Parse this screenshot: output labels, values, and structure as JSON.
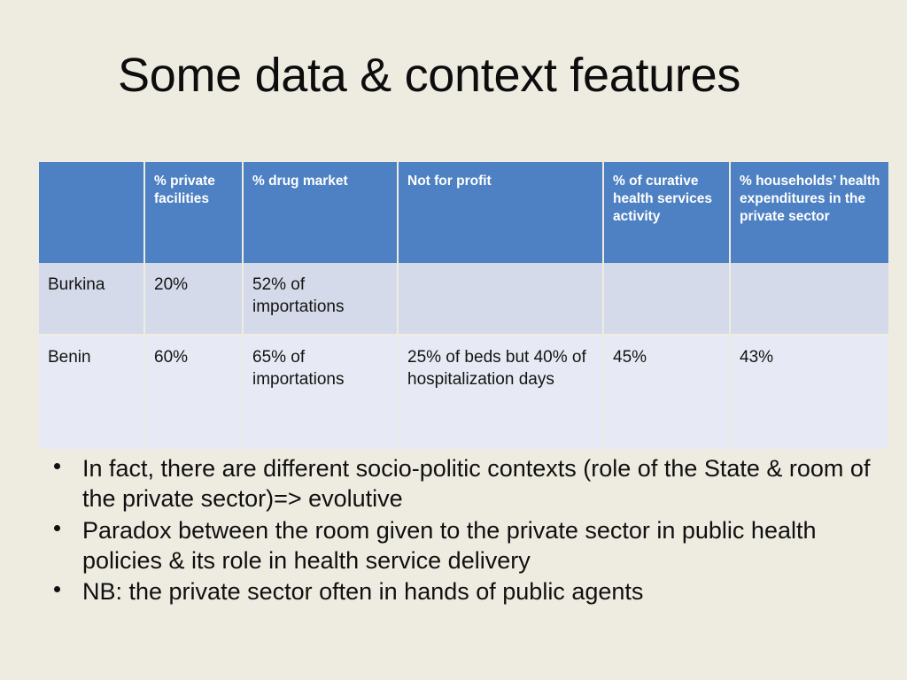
{
  "slide": {
    "title": "Some data & context features",
    "background_color": "#eeebe1"
  },
  "table": {
    "header_color": "#4e81c3",
    "row_colors": [
      "#d4dae9",
      "#e7eaf4"
    ],
    "columns": [
      "",
      "% private facilities",
      "% drug market",
      "Not for profit",
      "% of curative health services activity",
      "% households’ health expenditures in the private sector"
    ],
    "rows": [
      {
        "name": "Burkina",
        "private_facilities": "20%",
        "drug_market": "52% of importations",
        "not_for_profit": "",
        "curative_activity": "",
        "household_expenditures": ""
      },
      {
        "name": "Benin",
        "private_facilities": "60%",
        "drug_market": "65% of importations",
        "not_for_profit": "25% of beds but 40% of hospitalization days",
        "curative_activity": "45%",
        "household_expenditures": "43%"
      }
    ]
  },
  "bullets": [
    "In fact, there are different socio-politic contexts (role of the State & room of the private sector)=> evolutive",
    "Paradox between the room given to the private sector in public health policies & its role in health service delivery",
    "NB: the private sector often in hands of public agents"
  ]
}
